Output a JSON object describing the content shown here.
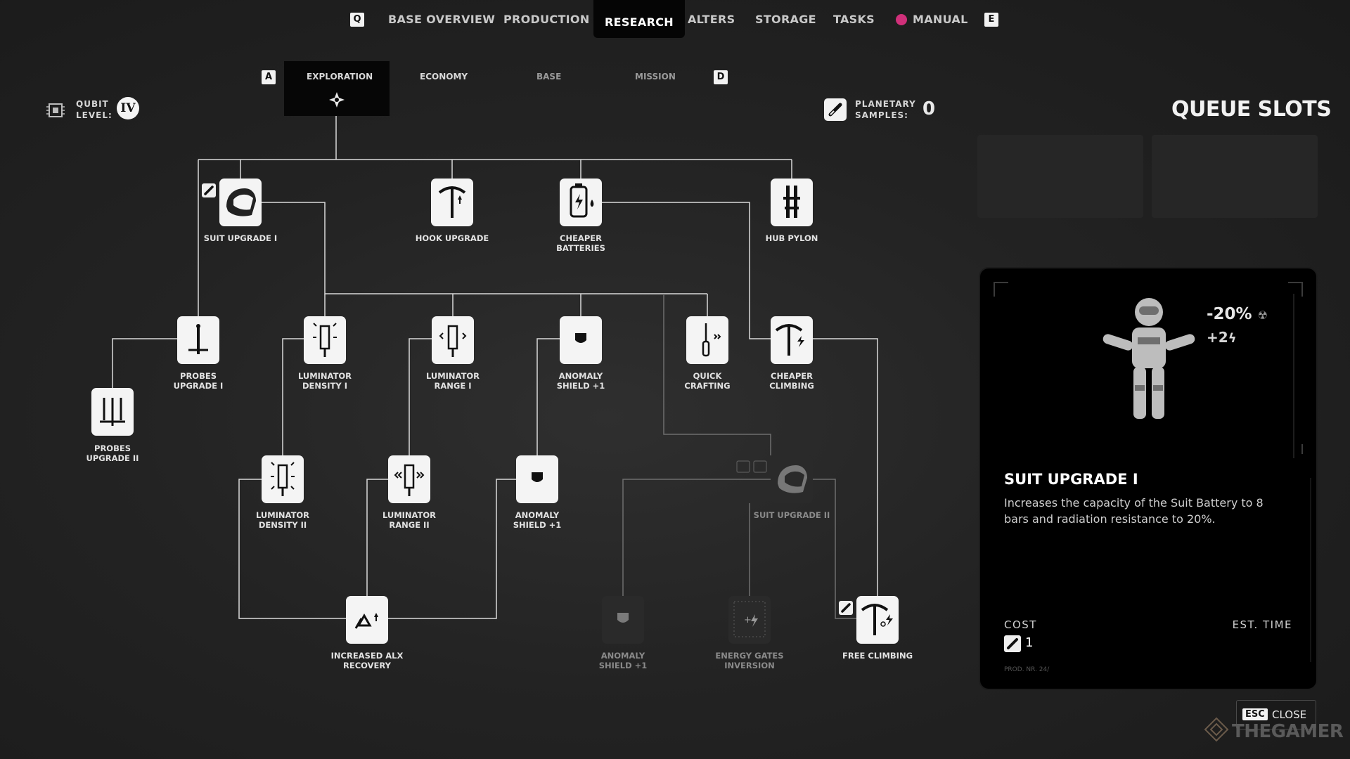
{
  "nav": {
    "left_key": "Q",
    "right_key": "E",
    "tabs": [
      {
        "label": "BASE OVERVIEW"
      },
      {
        "label": "PRODUCTION"
      },
      {
        "label": "RESEARCH"
      },
      {
        "label": "ALTERS"
      },
      {
        "label": "STORAGE"
      },
      {
        "label": "TASKS"
      },
      {
        "label": "MANUAL"
      }
    ],
    "active_tab": "RESEARCH",
    "manual_dot_color": "#d0307a"
  },
  "subnav": {
    "left_key": "A",
    "right_key": "D",
    "tabs": [
      {
        "label": "EXPLORATION"
      },
      {
        "label": "ECONOMY"
      },
      {
        "label": "BASE"
      },
      {
        "label": "MISSION"
      }
    ],
    "active_tab": "EXPLORATION"
  },
  "qubit": {
    "label_line1": "QUBIT",
    "label_line2": "LEVEL:",
    "value": "IV"
  },
  "samples": {
    "label_line1": "PLANETARY",
    "label_line2": "SAMPLES:",
    "value": "0"
  },
  "queue": {
    "title": "QUEUE SLOTS",
    "slots": 2
  },
  "tree": {
    "nodes": [
      {
        "id": "suit1",
        "line1": "SUIT UPGRADE I",
        "line2": "",
        "icon": "helmet-icon",
        "state": "selected"
      },
      {
        "id": "hook",
        "line1": "HOOK UPGRADE",
        "line2": "",
        "icon": "pickaxe-arrow-icon",
        "state": "available"
      },
      {
        "id": "batt",
        "line1": "CHEAPER",
        "line2": "BATTERIES",
        "icon": "battery-icon",
        "state": "available"
      },
      {
        "id": "pylon",
        "line1": "HUB PYLON",
        "line2": "",
        "icon": "pylon-icon",
        "state": "available"
      },
      {
        "id": "probes1",
        "line1": "PROBES",
        "line2": "UPGRADE I",
        "icon": "probe-icon",
        "state": "available"
      },
      {
        "id": "lumd1",
        "line1": "LUMINATOR",
        "line2": "DENSITY I",
        "icon": "luminator-density-icon",
        "state": "available"
      },
      {
        "id": "lumr1",
        "line1": "LUMINATOR",
        "line2": "RANGE I",
        "icon": "luminator-range-icon",
        "state": "available"
      },
      {
        "id": "anom1",
        "line1": "ANOMALY",
        "line2": "SHIELD +1",
        "icon": "shield-icon",
        "state": "available"
      },
      {
        "id": "quick",
        "line1": "QUICK",
        "line2": "CRAFTING",
        "icon": "screwdriver-icon",
        "state": "available"
      },
      {
        "id": "climb1",
        "line1": "CHEAPER",
        "line2": "CLIMBING",
        "icon": "pickaxe-bolt-icon",
        "state": "available"
      },
      {
        "id": "probes2",
        "line1": "PROBES",
        "line2": "UPGRADE II",
        "icon": "multi-probe-icon",
        "state": "available"
      },
      {
        "id": "lumd2",
        "line1": "LUMINATOR",
        "line2": "DENSITY II",
        "icon": "luminator-density-icon",
        "state": "available"
      },
      {
        "id": "lumr2",
        "line1": "LUMINATOR",
        "line2": "RANGE II",
        "icon": "luminator-range-icon",
        "state": "available"
      },
      {
        "id": "anom2",
        "line1": "ANOMALY",
        "line2": "SHIELD +1",
        "icon": "shield-icon",
        "state": "available"
      },
      {
        "id": "suit2",
        "line1": "SUIT UPGRADE II",
        "line2": "",
        "icon": "helmet-icon",
        "state": "locked"
      },
      {
        "id": "alx",
        "line1": "INCREASED ALX",
        "line2": "RECOVERY",
        "icon": "alx-icon",
        "state": "available"
      },
      {
        "id": "anom3",
        "line1": "ANOMALY",
        "line2": "SHIELD +1",
        "icon": "shield-icon",
        "state": "locked"
      },
      {
        "id": "energy",
        "line1": "ENERGY GATES",
        "line2": "INVERSION",
        "icon": "energy-gate-icon",
        "state": "locked"
      },
      {
        "id": "free",
        "line1": "FREE CLIMBING",
        "line2": "",
        "icon": "pickaxe-bolt-icon",
        "state": "available"
      }
    ]
  },
  "detail": {
    "title": "SUIT UPGRADE I",
    "description": "Increases the capacity of the Suit Battery to 8 bars and radiation resistance to 20%.",
    "stat1": "-20%",
    "stat2": "+2",
    "cost_label": "COST",
    "cost_value": "1",
    "est_label": "EST. TIME",
    "prod_text": "PROD. NR. 24/"
  },
  "close": {
    "key": "ESC",
    "label": "CLOSE"
  },
  "watermark": "THEGAMER"
}
